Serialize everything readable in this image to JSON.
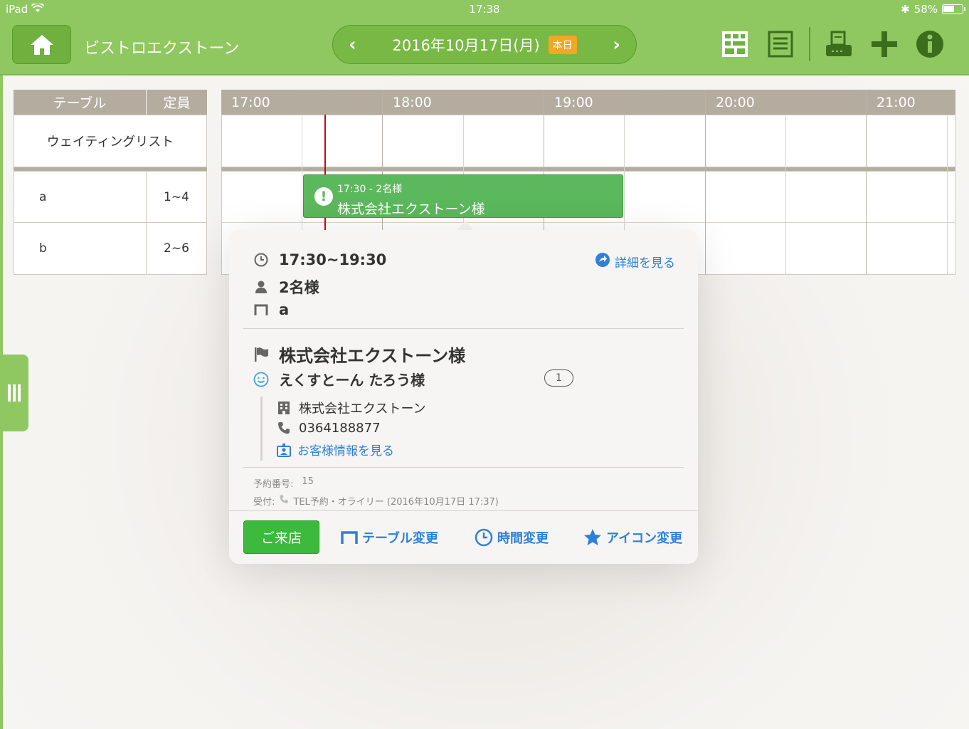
{
  "status_bar": {
    "device": "iPad",
    "time": "17:38",
    "battery": "58%"
  },
  "nav": {
    "shop_name": "ビストロエクストーン",
    "date": "2016年10月17日(月)",
    "today_badge": "本日"
  },
  "grid": {
    "col_table": "テーブル",
    "col_capacity": "定員",
    "waiting_list": "ウェイティングリスト",
    "times": [
      "17:00",
      "18:00",
      "19:00",
      "20:00",
      "21:00"
    ],
    "tables": [
      {
        "name": "a",
        "capacity": "1~4"
      },
      {
        "name": "b",
        "capacity": "2~6"
      }
    ]
  },
  "reservation_block": {
    "line1": "17:30 - 2名様",
    "line2": "株式会社エクストーン様"
  },
  "popover": {
    "time_range": "17:30~19:30",
    "detail_link": "詳細を見る",
    "party": "2名様",
    "table": "a",
    "company_name": "株式会社エクストーン様",
    "person_name": "えくすとーん たろう様",
    "visit_count": "1",
    "company": "株式会社エクストーン",
    "phone": "0364188877",
    "customer_link": "お客様情報を見る",
    "reservation_no_label": "予約番号:",
    "reservation_no": "15",
    "received_label": "受付:",
    "received_value": "TEL予約・オライリー (2016年10月17日 17:37)",
    "actions": {
      "visit": "ご来店",
      "change_table": "テーブル変更",
      "change_time": "時間変更",
      "change_icon": "アイコン変更"
    }
  },
  "colors": {
    "accent_green": "#8fc860",
    "link_blue": "#2f80d8",
    "now_line": "#d0021b",
    "today_badge": "#f5a623"
  }
}
